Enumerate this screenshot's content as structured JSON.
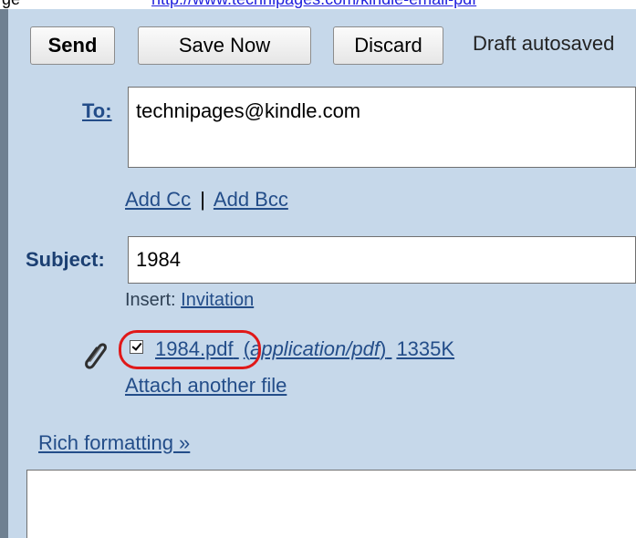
{
  "header": {
    "prefix": "ge",
    "link": "http://www.technipages.com/kindle-email-pdf"
  },
  "toolbar": {
    "send_label": "Send",
    "save_now_label": "Save Now",
    "discard_label": "Discard",
    "status_text": "Draft autosaved"
  },
  "compose": {
    "to_label": "To:",
    "to_value": "technipages@kindle.com",
    "add_cc_label": "Add Cc",
    "cc_separator": "|",
    "add_bcc_label": "Add Bcc",
    "subject_label": "Subject:",
    "subject_value": "1984",
    "insert_label": "Insert:",
    "insert_link": "Invitation",
    "attachment": {
      "checked": true,
      "file_name": "1984.pdf",
      "file_open": "(",
      "file_type": "application/pdf",
      "file_close": ")",
      "file_size": "1335K"
    },
    "attach_another_label": "Attach another file",
    "rich_formatting_label": "Rich formatting »",
    "body_value": ""
  },
  "icons": {
    "attachment": "paperclip-icon",
    "checkbox": "checkbox-checked-icon"
  },
  "colors": {
    "panel": "#c6d8ea",
    "left_bar": "#6f8091",
    "link": "#234d89",
    "highlight": "#e01919"
  }
}
